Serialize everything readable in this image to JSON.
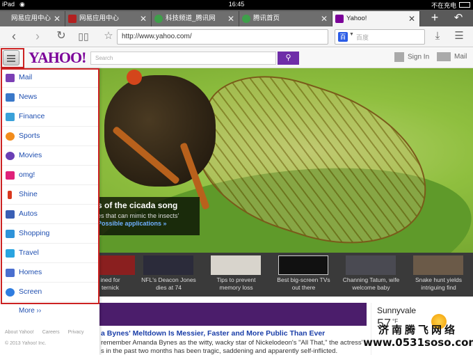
{
  "status_bar": {
    "device": "iPad",
    "time": "16:45",
    "charging": "不在充电"
  },
  "tabs": [
    {
      "label": "网易应用中心",
      "active": false
    },
    {
      "label": "网易应用中心",
      "active": false
    },
    {
      "label": "科技频道_腾讯网",
      "active": false
    },
    {
      "label": "腾讯首页",
      "active": false
    },
    {
      "label": "Yahoo!",
      "active": true
    }
  ],
  "toolbar": {
    "url": "http://www.yahoo.com/",
    "search_placeholder": "百度",
    "search_engine_glyph": "百"
  },
  "header": {
    "logo": "YAHOO!",
    "search_placeholder": "Search",
    "sign_in": "Sign In",
    "mail": "Mail"
  },
  "sidebar": {
    "items": [
      {
        "label": "Mail",
        "icon": "mail-icon",
        "color": "#7b3fb5"
      },
      {
        "label": "News",
        "icon": "news-icon",
        "color": "#3a78c9"
      },
      {
        "label": "Finance",
        "icon": "finance-icon",
        "color": "#3aa1d9"
      },
      {
        "label": "Sports",
        "icon": "sports-icon",
        "color": "#f28c1c"
      },
      {
        "label": "Movies",
        "icon": "movies-icon",
        "color": "#6a3fb5"
      },
      {
        "label": "omg!",
        "icon": "omg-icon",
        "color": "#e0217a"
      },
      {
        "label": "Shine",
        "icon": "shine-icon",
        "color": "#d9381e"
      },
      {
        "label": "Autos",
        "icon": "autos-icon",
        "color": "#3a5fb5"
      },
      {
        "label": "Shopping",
        "icon": "shopping-icon",
        "color": "#2e93d9"
      },
      {
        "label": "Travel",
        "icon": "travel-icon",
        "color": "#2aa4e0"
      },
      {
        "label": "Homes",
        "icon": "homes-icon",
        "color": "#4a6fcf"
      },
      {
        "label": "Screen",
        "icon": "screen-icon",
        "color": "#2f7de0"
      }
    ],
    "more": "More ››",
    "footer_links": [
      "About Yahoo!",
      "Careers",
      "Privacy"
    ],
    "copyright": "© 2013 Yahoo! Inc."
  },
  "hero": {
    "title": "s of the cicada song",
    "subtitle": "es that can mimic the insects'",
    "link": "Possible applications »"
  },
  "thumbs": [
    {
      "caption": "ined for\nternick"
    },
    {
      "caption": "NFL's Deacon Jones\ndies at 74"
    },
    {
      "caption": "Tips to prevent\nmemory loss"
    },
    {
      "caption": "Best big-screen TVs\nout there"
    },
    {
      "caption": "Channing Tatum, wife\nwelcome baby"
    },
    {
      "caption": "Snake hunt yields\nintriguing find"
    }
  ],
  "story": {
    "title": "a Bynes' Meltdown Is Messier, Faster and More Public Than Ever",
    "body": "remember Amanda Bynes as the witty, wacky star of Nickelodeon's \"All That,\" the actress' s in the past two months has been tragic, saddening and apparently self-inflicted."
  },
  "weather": {
    "city": "Sunnyvale",
    "temp": "57",
    "unit": "°F"
  },
  "watermark": {
    "line1": "济南腾飞网络",
    "line2": "www.0531soso.com"
  }
}
